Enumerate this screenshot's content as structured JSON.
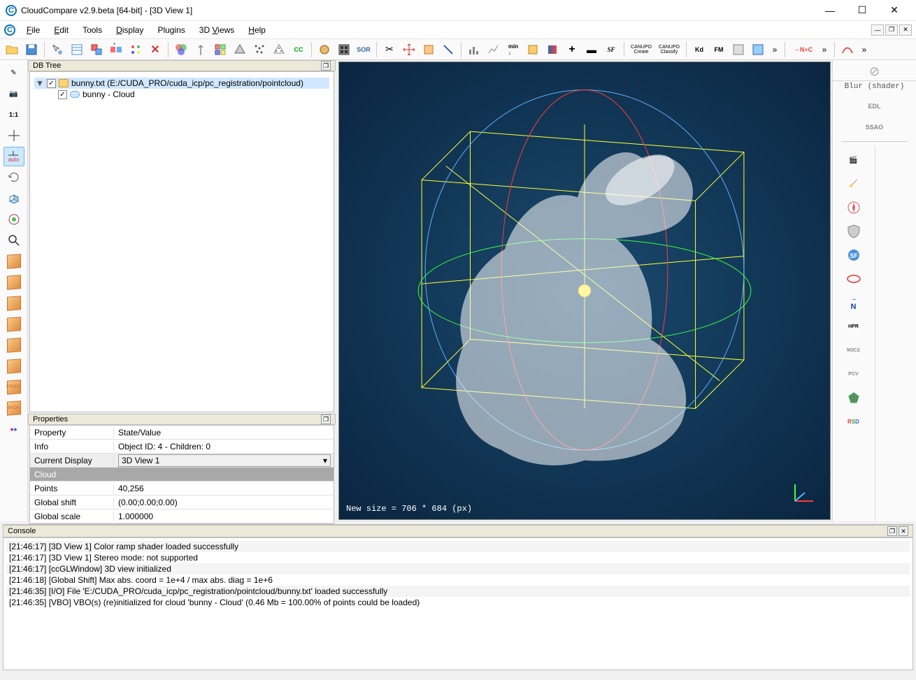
{
  "window": {
    "title": "CloudCompare v2.9.beta [64-bit] - [3D View 1]"
  },
  "menu": {
    "file": "File",
    "edit": "Edit",
    "tools": "Tools",
    "display": "Display",
    "plugins": "Plugins",
    "views": "3D Views",
    "help": "Help"
  },
  "toolbar": {
    "nplusc": "N+C",
    "sor": "SOR",
    "kd": "Kd",
    "fm": "FM",
    "cc": "CC",
    "canupoCreate": "CANUPO",
    "canupoCreate2": "Create",
    "canupoClassify": "CANUPO",
    "canupoClassify2": "Classify",
    "sf": "SF"
  },
  "leftTools": {
    "snapshot": "📷",
    "ratio": "1:1",
    "auto": "auto",
    "front": "FRONT",
    "back": "BACK",
    "flickr": "••"
  },
  "dbtree": {
    "title": "DB Tree",
    "root_label": "bunny.txt (E:/CUDA_PRO/cuda_icp/pc_registration/pointcloud)",
    "child_label": "bunny - Cloud"
  },
  "properties": {
    "title": "Properties",
    "header_prop": "Property",
    "header_val": "State/Value",
    "rows": {
      "info_label": "Info",
      "info_val": "Object ID: 4 - Children: 0",
      "disp_label": "Current Display",
      "disp_val": "3D View 1",
      "section": "Cloud",
      "points_label": "Points",
      "points_val": "40,256",
      "shift_label": "Global shift",
      "shift_val": "(0.00;0.00;0.00)",
      "scale_label": "Global scale",
      "scale_val": "1.000000"
    }
  },
  "viewport": {
    "status": "New size = 706 * 684 (px)"
  },
  "right": {
    "blur": "Blur (shader)",
    "edl": "EDL",
    "ssao": "SSAO",
    "n": "N",
    "hpr": "HPR",
    "m3c2": "M3C2",
    "pcv": "PCV",
    "rsd": "RSD"
  },
  "console": {
    "title": "Console",
    "lines": [
      "[21:46:17] [3D View 1] Color ramp shader loaded successfully",
      "[21:46:17] [3D View 1] Stereo mode: not supported",
      "[21:46:17] [ccGLWindow] 3D view initialized",
      "[21:46:18] [Global Shift] Max abs. coord = 1e+4 / max abs. diag = 1e+6",
      "[21:46:35] [I/O] File 'E:/CUDA_PRO/cuda_icp/pc_registration/pointcloud/bunny.txt' loaded successfully",
      "[21:46:35] [VBO] VBO(s) (re)initialized for cloud 'bunny - Cloud' (0.46 Mb = 100.00% of points could be loaded)"
    ]
  }
}
